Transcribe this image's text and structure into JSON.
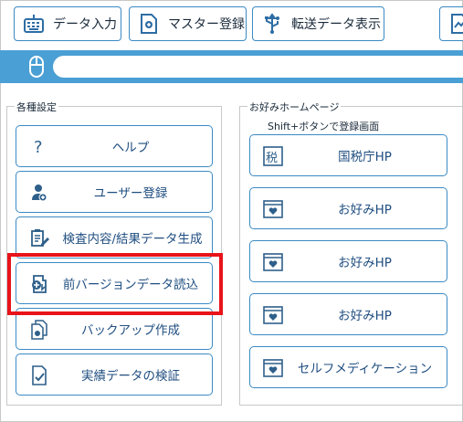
{
  "toolbar": {
    "data_input": "データ入力",
    "master_register": "マスター登録",
    "transfer_display": "転送データ表示"
  },
  "left_group": {
    "title": "各種設定",
    "buttons": [
      {
        "label": "ヘルプ",
        "icon": "help-icon"
      },
      {
        "label": "ユーザー登録",
        "icon": "user-icon"
      },
      {
        "label": "検査内容/結果データ生成",
        "icon": "document-edit-icon"
      },
      {
        "label": "前バージョンデータ読込",
        "icon": "data-import-icon"
      },
      {
        "label": "バックアップ作成",
        "icon": "backup-icon"
      },
      {
        "label": "実績データの検証",
        "icon": "verify-icon"
      }
    ]
  },
  "right_group": {
    "title": "お好みホームページ",
    "hint": "Shift+ボタンで登録画面",
    "buttons": [
      {
        "label": "国税庁HP",
        "icon": "tax-icon",
        "icon_text": "税"
      },
      {
        "label": "お好みHP",
        "icon": "browser-heart-icon"
      },
      {
        "label": "お好みHP",
        "icon": "browser-heart-icon"
      },
      {
        "label": "お好みHP",
        "icon": "browser-heart-icon"
      },
      {
        "label": "セルフメディケーション",
        "icon": "browser-heart-icon"
      }
    ]
  },
  "colors": {
    "accent": "#4a9fd4",
    "border": "#3a8ac4",
    "label": "#1f4e80",
    "highlight": "#e8141a"
  }
}
